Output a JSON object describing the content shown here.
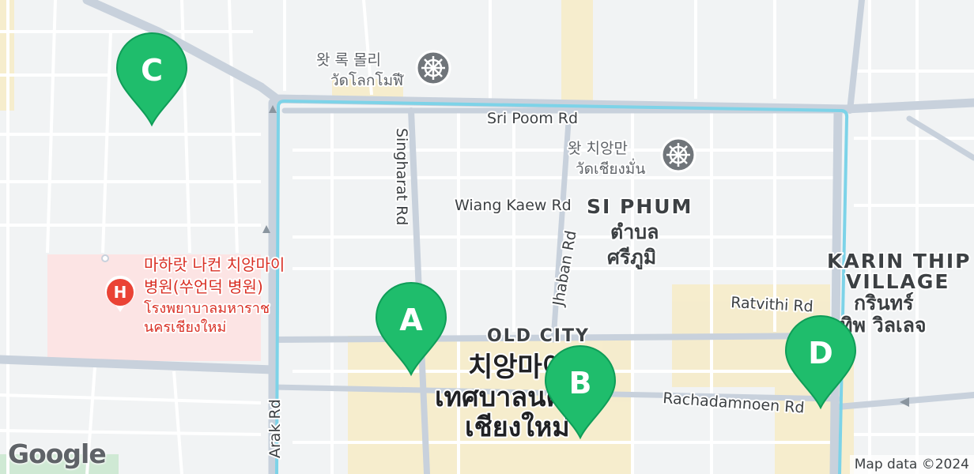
{
  "map": {
    "colors": {
      "land": "#f1f3f4",
      "road_major": "#c8d1dc",
      "road_minor": "#ffffff",
      "moat": "#7dd3e8",
      "tourist_area": "#f6ecc9",
      "hospital_area": "#fce4e4",
      "park": "#cfe9d4",
      "marker": "#1fbd6c",
      "hospital": "#ea4335"
    },
    "roads": {
      "sri_poom": "Sri Poom Rd",
      "singharat": "Singharat Rd",
      "wiang_kaew": "Wiang Kaew Rd",
      "jhaban": "Jhaban Rd",
      "ratvithi": "Ratvithi Rd",
      "rachadamnoen": "Rachadamnoen Rd",
      "arak": "Arak Rd"
    },
    "areas": {
      "si_phum_en": "SI PHUM",
      "si_phum_th1": "ตำบล",
      "si_phum_th2": "ศรีภูมิ",
      "karin_en1": "KARIN THIP",
      "karin_en2": "VILLAGE",
      "karin_th1": "กรินทร์",
      "karin_th2": "ทิพ วิลเลจ",
      "old_city": "OLD CITY",
      "chiangmai_ko": "치앙마이",
      "chiangmai_th1": "เทศบาลนคร",
      "chiangmai_th2": "เชียงใหม่"
    },
    "pois": {
      "wat_lok_ko": "왓 록 몰리",
      "wat_lok_th": "วัดโลกโมฬี",
      "wat_lok_icon": "temple-icon",
      "wat_chiang_ko": "왓 치앙만",
      "wat_chiang_th": "วัดเชียงมั่น",
      "wat_chiang_icon": "temple-icon",
      "hospital_ko1": "마하랏 나컨 치앙마이",
      "hospital_ko2": "병원(쑤언덕 병원)",
      "hospital_th1": "โรงพยาบาลมหาราช",
      "hospital_th2": "นครเชียงใหม่",
      "hospital_icon_letter": "H"
    },
    "markers": {
      "a": "A",
      "b": "B",
      "c": "C",
      "d": "D"
    },
    "branding": {
      "logo": "Google",
      "attribution": "Map data ©2024"
    }
  }
}
